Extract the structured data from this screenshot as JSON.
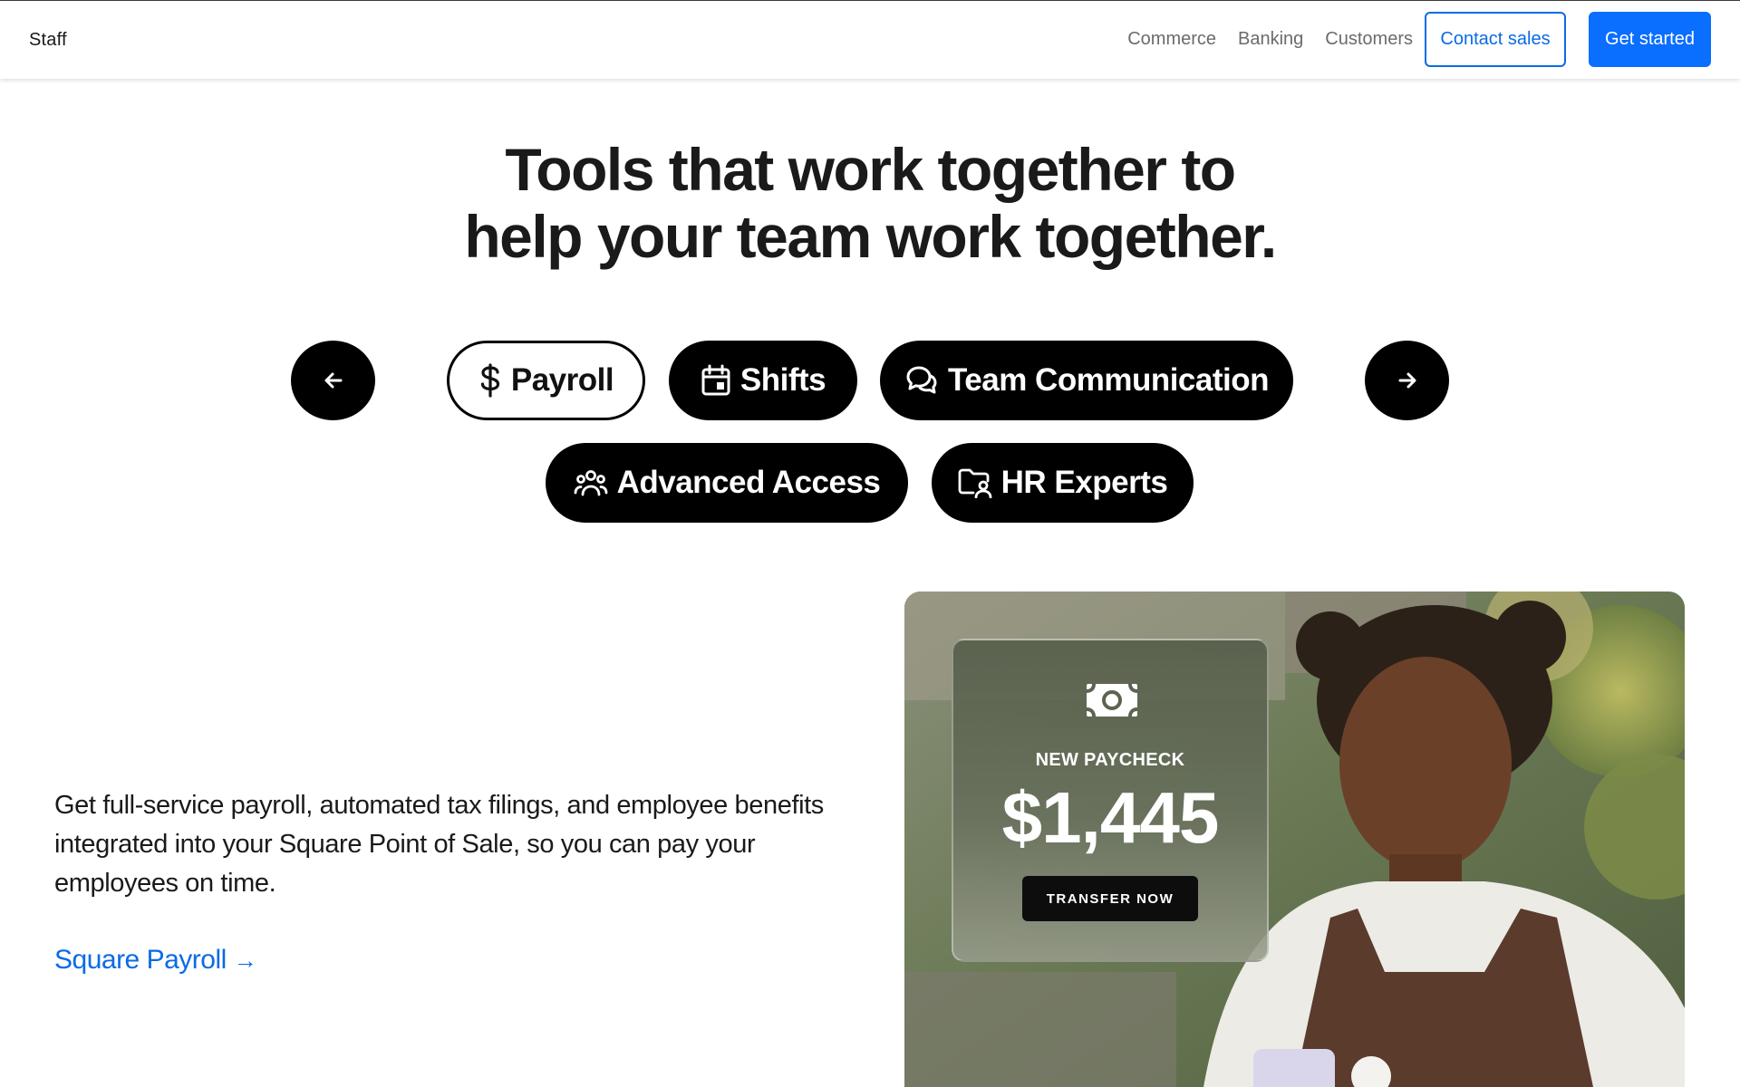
{
  "header": {
    "brand": "Staff",
    "nav": [
      "Commerce",
      "Banking",
      "Customers"
    ],
    "contact_label": "Contact sales",
    "start_label": "Get started"
  },
  "hero": {
    "title_line1": "Tools that work together to",
    "title_line2": "help your team work together."
  },
  "tabs": [
    {
      "label": "Payroll",
      "icon": "dollar-icon",
      "active": true
    },
    {
      "label": "Shifts",
      "icon": "calendar-icon",
      "active": false
    },
    {
      "label": "Team Communication",
      "icon": "chat-bubbles-icon",
      "active": false
    },
    {
      "label": "Advanced Access",
      "icon": "people-group-icon",
      "active": false
    },
    {
      "label": "HR Experts",
      "icon": "folder-person-icon",
      "active": false
    }
  ],
  "content": {
    "description": "Get full-service payroll, automated tax filings, and employee benefits integrated into your Square Point of Sale, so you can pay your employees on time.",
    "link_label": "Square Payroll",
    "link_arrow": "→"
  },
  "paycheck": {
    "label": "NEW PAYCHECK",
    "amount": "$1,445",
    "button": "TRANSFER NOW",
    "icon": "cash-bill-icon"
  },
  "colors": {
    "accent_blue": "#0a6eff",
    "link_blue": "#0a6be6",
    "pill_black": "#000000"
  }
}
